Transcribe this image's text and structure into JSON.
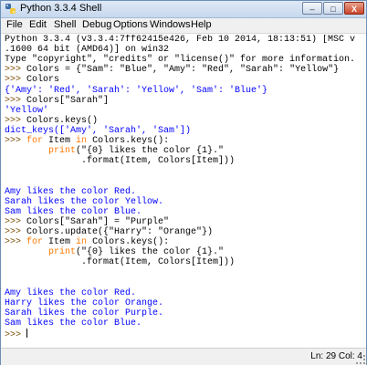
{
  "window": {
    "title": "Python 3.3.4 Shell",
    "minimize_glyph": "–",
    "maximize_glyph": "□",
    "close_glyph": "X"
  },
  "menu": [
    "File",
    "Edit",
    "Shell",
    "Debug",
    "Options",
    "Windows",
    "Help"
  ],
  "shell": {
    "l0": "Python 3.3.4 (v3.3.4:7ff62415e426, Feb 10 2014, 18:13:51) [MSC v",
    "l1": ".1600 64 bit (AMD64)] on win32",
    "l2": "Type \"copyright\", \"credits\" or \"license()\" for more information.",
    "l3_prompt": ">>> ",
    "l3_code": "Colors = {\"Sam\": \"Blue\", \"Amy\": \"Red\", \"Sarah\": \"Yellow\"}",
    "l4_prompt": ">>> ",
    "l4_code": "Colors",
    "l5": "{'Amy': 'Red', 'Sarah': 'Yellow', 'Sam': 'Blue'}",
    "l6_prompt": ">>> ",
    "l6_code": "Colors[\"Sarah\"]",
    "l7": "'Yellow'",
    "l8_prompt": ">>> ",
    "l8_code": "Colors.keys()",
    "l9": "dict_keys(['Amy', 'Sarah', 'Sam'])",
    "l10_prompt": ">>> ",
    "l10_kw1": "for",
    "l10_mid": " Item ",
    "l10_kw2": "in",
    "l10_rest": " Colors.keys():",
    "l11_indent": "        ",
    "l11_fn": "print",
    "l11_rest": "(\"{0} likes the color {1}.\"",
    "l12": "              .format(Item, Colors[Item]))",
    "l15": "Amy likes the color Red.",
    "l16": "Sarah likes the color Yellow.",
    "l17": "Sam likes the color Blue.",
    "l18_prompt": ">>> ",
    "l18_code": "Colors[\"Sarah\"] = \"Purple\"",
    "l19_prompt": ">>> ",
    "l19_code": "Colors.update({\"Harry\": \"Orange\"})",
    "l20_prompt": ">>> ",
    "l20_kw1": "for",
    "l20_mid": " Item ",
    "l20_kw2": "in",
    "l20_rest": " Colors.keys():",
    "l21_indent": "        ",
    "l21_fn": "print",
    "l21_rest": "(\"{0} likes the color {1}.\"",
    "l22": "              .format(Item, Colors[Item]))",
    "l25": "Amy likes the color Red.",
    "l26": "Harry likes the color Orange.",
    "l27": "Sarah likes the color Purple.",
    "l28": "Sam likes the color Blue.",
    "l29_prompt": ">>> "
  },
  "status": {
    "position": "Ln: 29 Col: 4"
  }
}
